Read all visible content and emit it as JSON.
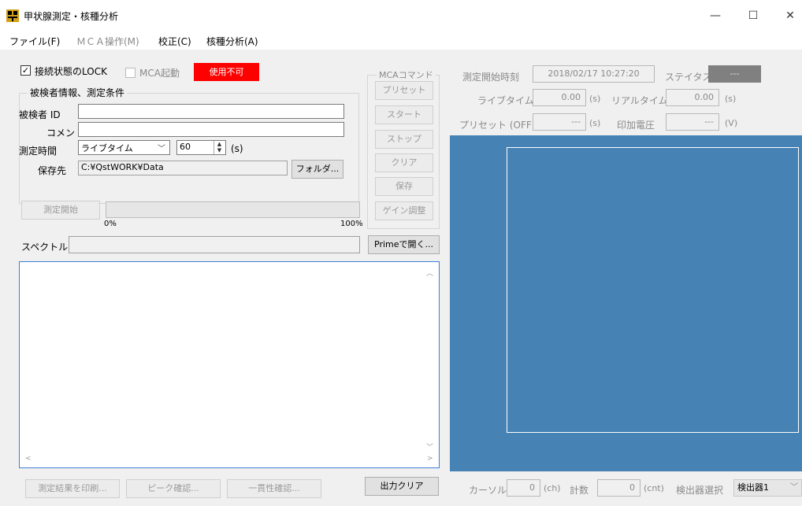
{
  "window": {
    "title": "甲状腺測定・核種分析",
    "minimize": "—",
    "maximize": "☐",
    "close": "✕"
  },
  "menu": [
    {
      "label": "ファイル(F)"
    },
    {
      "label": "ＭＣＡ操作(M)"
    },
    {
      "label": "校正(C)"
    },
    {
      "label": "核種分析(A)"
    }
  ],
  "lock": {
    "checkmark": "✓",
    "label": "接続状態のLOCK",
    "mca_start": "MCA起動",
    "status_button": "使用不可",
    "status_color": "#ff0000"
  },
  "patient": {
    "group_title": "被検者情報、測定条件",
    "id_label": "被検者 ID",
    "id_value": "",
    "comment_label": "コメント",
    "comment_value": "",
    "time_label": "測定時間",
    "time_mode": "ライブタイム",
    "time_value": "60",
    "time_unit": "(s)",
    "save_label": "保存先",
    "save_path": "C:¥QstWORK¥Data",
    "folder_button": "フォルダ..."
  },
  "measure": {
    "start_button": "測定開始",
    "progress_start": "0%",
    "progress_end": "100%",
    "progress_fraction": 0
  },
  "spectrum": {
    "label": "スペクトル",
    "value": "",
    "open_button": "Primeで開く..."
  },
  "mca_commands": {
    "title": "MCAコマンド",
    "buttons": [
      "プリセット",
      "スタート",
      "ストップ",
      "クリア",
      "保存",
      "ゲイン調整"
    ]
  },
  "status_panel": {
    "start_time_label": "測定開始時刻",
    "start_time": "2018/02/17 10:27:20",
    "status_label": "ステイタス",
    "status_value": "---",
    "live_label": "ライブタイム",
    "live_value": "0.00",
    "live_unit": "(s)",
    "real_label": "リアルタイム",
    "real_value": "0.00",
    "real_unit": "(s)",
    "preset_label": "プリセット (OFF)",
    "preset_value": "---",
    "preset_unit": "(s)",
    "voltage_label": "印加電圧",
    "voltage_value": "---",
    "voltage_unit": "(V)"
  },
  "bottom": {
    "print_button": "測定結果を印刷...",
    "peak_button": "ピーク確認...",
    "consistency_button": "一貫性確認...",
    "clear_button": "出力クリア",
    "cursor_label": "カーソル",
    "cursor_value": "0",
    "cursor_unit": "(ch)",
    "count_label": "計数",
    "count_value": "0",
    "count_unit": "(cnt)",
    "detector_label": "検出器選択",
    "detector_value": "検出器1"
  },
  "colors": {
    "plot_bg": "#4682b4",
    "accent_red": "#ff0000"
  }
}
